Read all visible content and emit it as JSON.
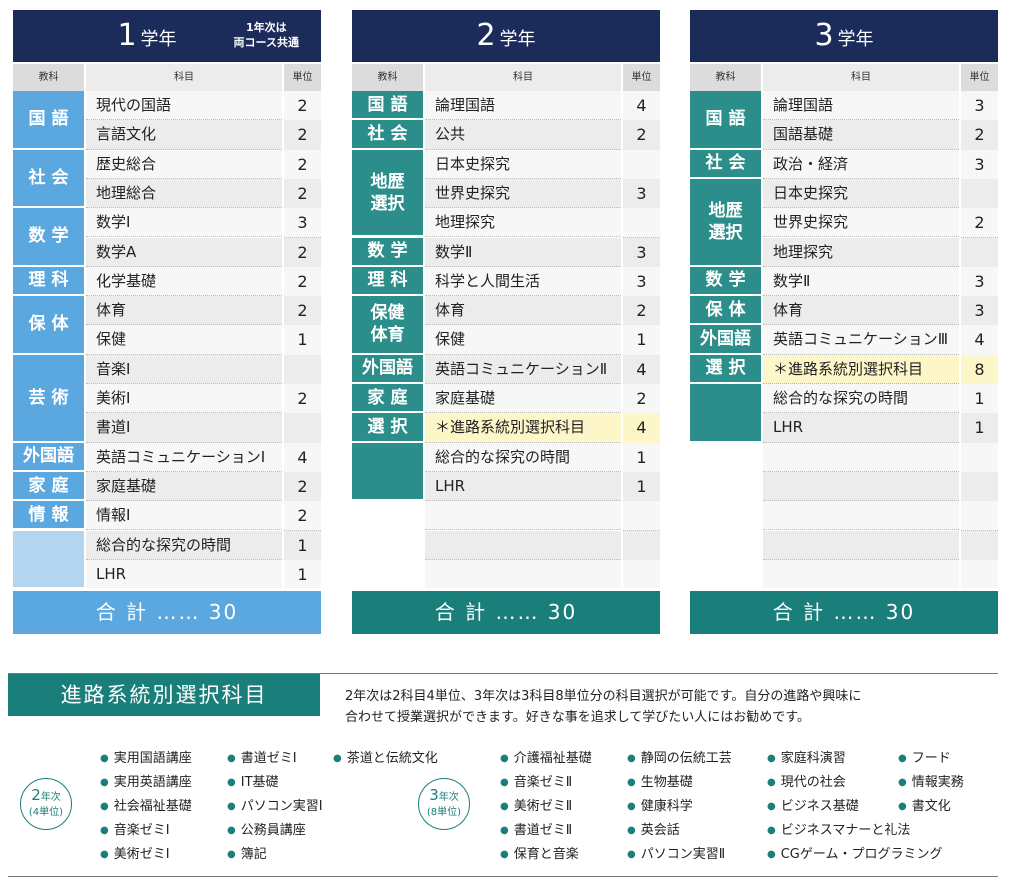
{
  "year1": {
    "grade": "1",
    "suffix": "学年",
    "note_l1": "1年次は",
    "note_l2": "両コース共通",
    "col_category": "教科",
    "col_subject": "科目",
    "col_unit": "単位",
    "rows": [
      [
        "現代の国語",
        "2"
      ],
      [
        "言語文化",
        "2"
      ],
      [
        "歴史総合",
        "2"
      ],
      [
        "地理総合",
        "2"
      ],
      [
        "数学Ⅰ",
        "3"
      ],
      [
        "数学A",
        "2"
      ],
      [
        "化学基礎",
        "2"
      ],
      [
        "体育",
        "2"
      ],
      [
        "保健",
        "1"
      ],
      [
        "音楽Ⅰ",
        ""
      ],
      [
        "美術Ⅰ",
        "2"
      ],
      [
        "書道Ⅰ",
        ""
      ],
      [
        "英語コミュニケーションⅠ",
        "4"
      ],
      [
        "家庭基礎",
        "2"
      ],
      [
        "情報Ⅰ",
        "2"
      ],
      [
        "総合的な探究の時間",
        "1"
      ],
      [
        "LHR",
        "1"
      ]
    ],
    "categories": [
      [
        "国 語",
        0,
        2
      ],
      [
        "社 会",
        2,
        2
      ],
      [
        "数 学",
        4,
        2
      ],
      [
        "理 科",
        6,
        1
      ],
      [
        "保 体",
        7,
        2
      ],
      [
        "芸 術",
        9,
        3
      ],
      [
        "外国語",
        12,
        1
      ],
      [
        "家 庭",
        13,
        1
      ],
      [
        "情 報",
        14,
        1
      ],
      [
        "",
        15,
        2
      ]
    ],
    "total": "合 計 …… 30"
  },
  "year2": {
    "grade": "2",
    "suffix": "学年",
    "col_category": "教科",
    "col_subject": "科目",
    "col_unit": "単位",
    "rows": [
      [
        "論理国語",
        "4"
      ],
      [
        "公共",
        "2"
      ],
      [
        "日本史探究",
        ""
      ],
      [
        "世界史探究",
        "3"
      ],
      [
        "地理探究",
        ""
      ],
      [
        "数学Ⅱ",
        "3"
      ],
      [
        "科学と人間生活",
        "3"
      ],
      [
        "体育",
        "2"
      ],
      [
        "保健",
        "1"
      ],
      [
        "英語コミュニケーションⅡ",
        "4"
      ],
      [
        "家庭基礎",
        "2"
      ],
      [
        "＊進路系統別選択科目",
        "4"
      ],
      [
        "総合的な探究の時間",
        "1"
      ],
      [
        "LHR",
        "1"
      ],
      [
        "",
        ""
      ],
      [
        "",
        ""
      ],
      [
        "",
        ""
      ]
    ],
    "categories": [
      [
        "国 語",
        0,
        1
      ],
      [
        "社 会",
        1,
        1
      ],
      [
        "地歴\n選択",
        2,
        3
      ],
      [
        "数 学",
        5,
        1
      ],
      [
        "理 科",
        6,
        1
      ],
      [
        "保健\n体育",
        7,
        2
      ],
      [
        "外国語",
        9,
        1
      ],
      [
        "家 庭",
        10,
        1
      ],
      [
        "選 択",
        11,
        1
      ],
      [
        "",
        12,
        2
      ]
    ],
    "highlight": 11,
    "total": "合 計 …… 30"
  },
  "year3": {
    "grade": "3",
    "suffix": "学年",
    "col_category": "教科",
    "col_subject": "科目",
    "col_unit": "単位",
    "rows": [
      [
        "論理国語",
        "3"
      ],
      [
        "国語基礎",
        "2"
      ],
      [
        "政治・経済",
        "3"
      ],
      [
        "日本史探究",
        ""
      ],
      [
        "世界史探究",
        "2"
      ],
      [
        "地理探究",
        ""
      ],
      [
        "数学Ⅱ",
        "3"
      ],
      [
        "体育",
        "3"
      ],
      [
        "英語コミュニケーションⅢ",
        "4"
      ],
      [
        "＊進路系統別選択科目",
        "8"
      ],
      [
        "総合的な探究の時間",
        "1"
      ],
      [
        "LHR",
        "1"
      ],
      [
        "",
        ""
      ],
      [
        "",
        ""
      ],
      [
        "",
        ""
      ],
      [
        "",
        ""
      ],
      [
        "",
        ""
      ]
    ],
    "categories": [
      [
        "国 語",
        0,
        2
      ],
      [
        "社 会",
        2,
        1
      ],
      [
        "地歴\n選択",
        3,
        3
      ],
      [
        "数 学",
        6,
        1
      ],
      [
        "保 体",
        7,
        1
      ],
      [
        "外国語",
        8,
        1
      ],
      [
        "選 択",
        9,
        1
      ],
      [
        "",
        10,
        2
      ]
    ],
    "highlight": 9,
    "total": "合 計 …… 30"
  },
  "path": {
    "title": "進路系統別選択科目",
    "desc1": "2年次は2科目4単位、3年次は3科目8単位分の科目選択が可能です。自分の進路や興味に",
    "desc2": "合わせて授業選択ができます。好きな事を追求して学びたい人にはお勧めです。",
    "badge2_num": "2",
    "badge2_small": "年次",
    "badge2_units": "(4単位)",
    "badge3_num": "3",
    "badge3_small": "年次",
    "badge3_units": "(8単位)",
    "y2_col1": [
      "実用国語講座",
      "実用英語講座",
      "社会福祉基礎",
      "音楽ゼミⅠ",
      "美術ゼミⅠ"
    ],
    "y2_col2": [
      "書道ゼミⅠ",
      "IT基礎",
      "パソコン実習Ⅰ",
      "公務員講座",
      "簿記"
    ],
    "y2_col3": [
      "茶道と伝統文化"
    ],
    "y3_col1": [
      "介護福祉基礎",
      "音楽ゼミⅡ",
      "美術ゼミⅡ",
      "書道ゼミⅡ",
      "保育と音楽"
    ],
    "y3_col2": [
      "静岡の伝統工芸",
      "生物基礎",
      "健康科学",
      "英会話",
      "パソコン実習Ⅱ"
    ],
    "y3_col3": [
      "家庭科演習",
      "現代の社会",
      "ビジネス基礎",
      "ビジネスマナーと礼法",
      "CGゲーム・プログラミング"
    ],
    "y3_col4": [
      "フード",
      "情報実務",
      "書文化"
    ]
  }
}
